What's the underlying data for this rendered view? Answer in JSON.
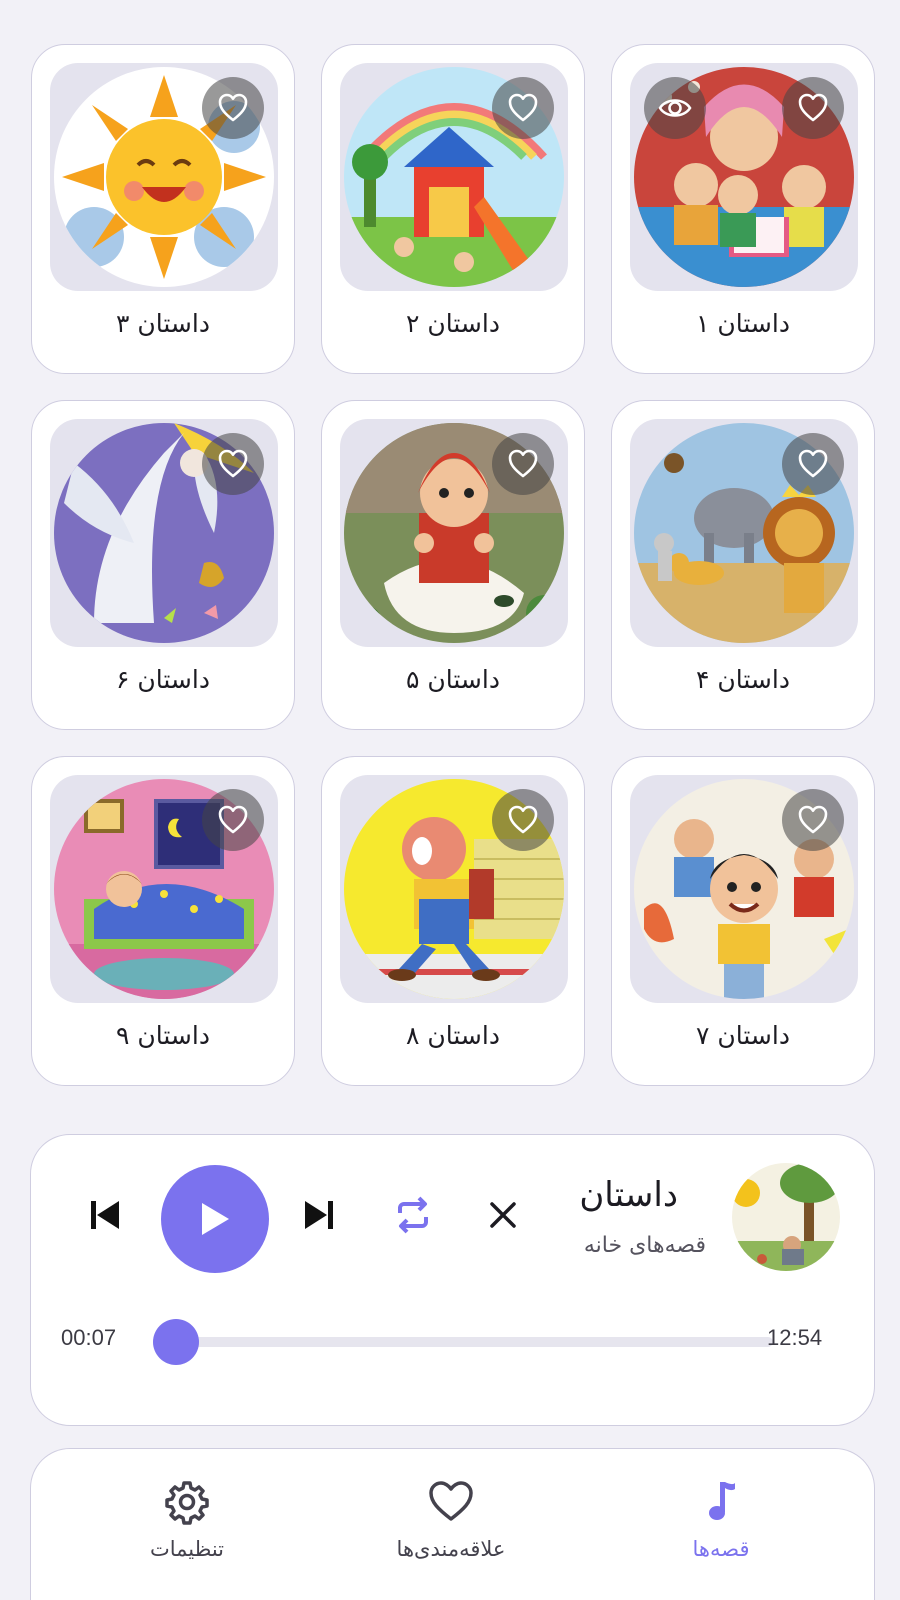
{
  "accent_color": "#7b72ee",
  "stories": [
    {
      "title": "داستان ۱",
      "art": "grandma-reading",
      "favorite": false,
      "viewed": true
    },
    {
      "title": "داستان ۲",
      "art": "playground",
      "favorite": false,
      "viewed": false
    },
    {
      "title": "داستان ۳",
      "art": "smiling-sun",
      "favorite": false,
      "viewed": false
    },
    {
      "title": "داستان ۴",
      "art": "lion-animals",
      "favorite": false,
      "viewed": false
    },
    {
      "title": "داستان ۵",
      "art": "red-hood-girl",
      "favorite": false,
      "viewed": false
    },
    {
      "title": "داستان ۶",
      "art": "moon-fairy",
      "favorite": false,
      "viewed": false
    },
    {
      "title": "داستان ۷",
      "art": "boy-friends",
      "favorite": false,
      "viewed": false
    },
    {
      "title": "داستان ۸",
      "art": "walking-man",
      "favorite": false,
      "viewed": false
    },
    {
      "title": "داستان ۹",
      "art": "sleeping-child",
      "favorite": false,
      "viewed": false
    }
  ],
  "player": {
    "title": "داستان",
    "subtitle": "قصه‌های خانه",
    "elapsed": "00:07",
    "duration": "12:54",
    "progress": 0.009,
    "icons": {
      "prev": "skip-previous-icon",
      "play": "play-icon",
      "next": "skip-next-icon",
      "repeat": "repeat-icon",
      "close": "close-icon"
    }
  },
  "nav": {
    "settings": "تنظیمات",
    "favorites": "علاقه‌مندی‌ها",
    "stories": "قصه‌ها",
    "active": "stories"
  }
}
